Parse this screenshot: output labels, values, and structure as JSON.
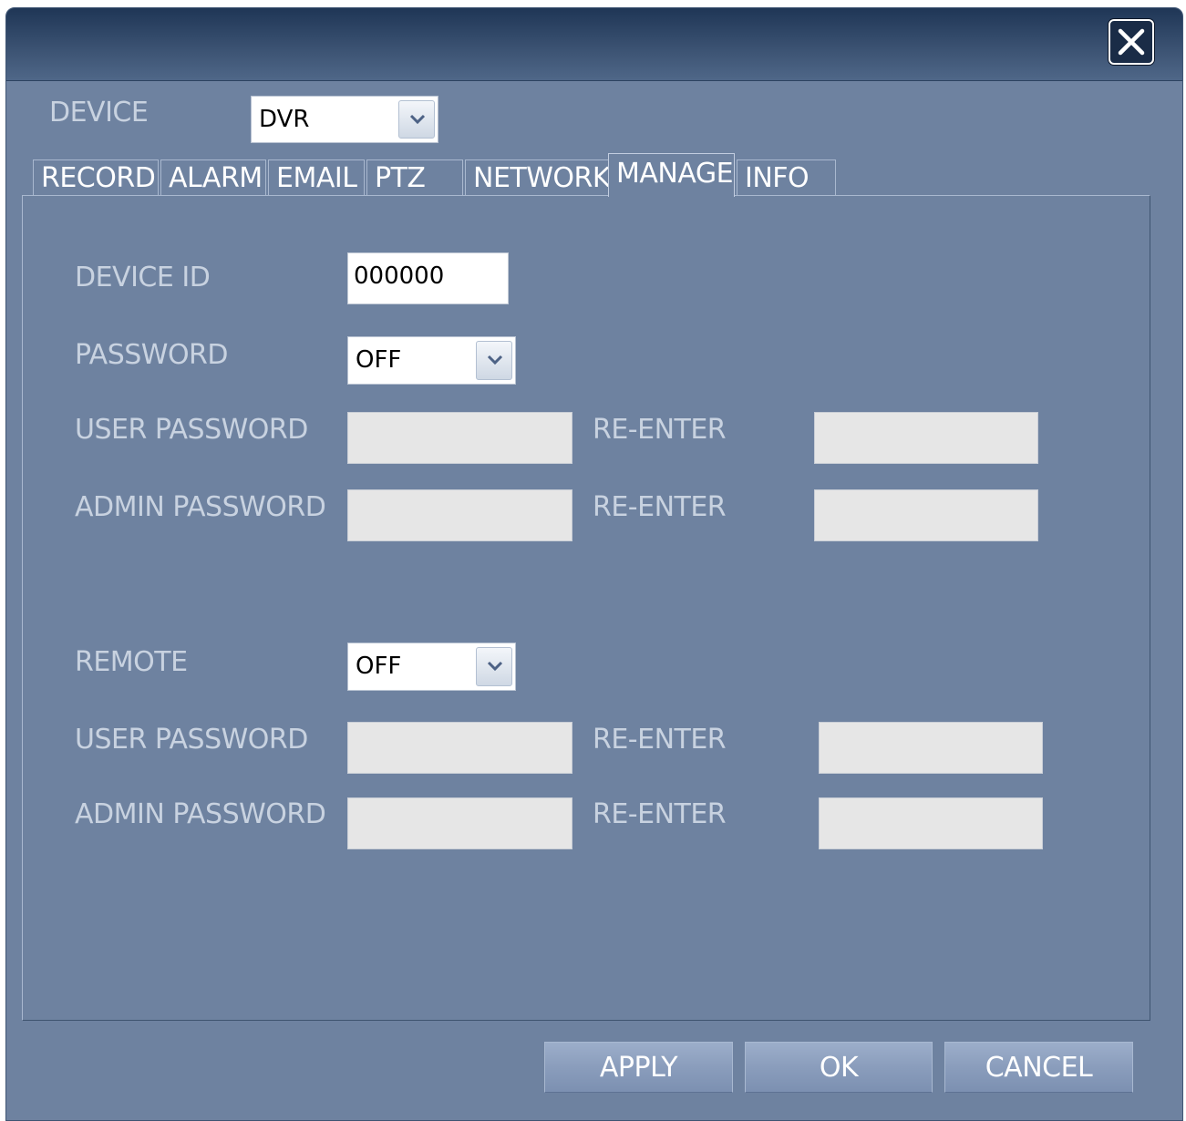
{
  "titlebar": {
    "close_icon": "close-icon"
  },
  "device": {
    "label": "DEVICE",
    "selected": "DVR"
  },
  "tabs": [
    {
      "label": "RECORD"
    },
    {
      "label": "ALARM"
    },
    {
      "label": "EMAIL"
    },
    {
      "label": "PTZ"
    },
    {
      "label": "NETWORK"
    },
    {
      "label": "MANAGE",
      "active": true
    },
    {
      "label": "INFO"
    }
  ],
  "manage": {
    "device_id": {
      "label": "DEVICE ID",
      "value": "000000"
    },
    "password": {
      "label": "PASSWORD",
      "selected": "OFF"
    },
    "local_user_password": {
      "label": "USER PASSWORD",
      "reenter_label": "RE-ENTER"
    },
    "local_admin_password": {
      "label": "ADMIN PASSWORD",
      "reenter_label": "RE-ENTER"
    },
    "remote": {
      "label": "REMOTE",
      "selected": "OFF"
    },
    "remote_user_password": {
      "label": "USER PASSWORD",
      "reenter_label": "RE-ENTER"
    },
    "remote_admin_password": {
      "label": "ADMIN PASSWORD",
      "reenter_label": "RE-ENTER"
    }
  },
  "buttons": {
    "apply": "APPLY",
    "ok": "OK",
    "cancel": "CANCEL"
  },
  "colors": {
    "window_bg": "#6e82a0",
    "titlebar": "#2c4364",
    "button": "#8a9dbc"
  }
}
